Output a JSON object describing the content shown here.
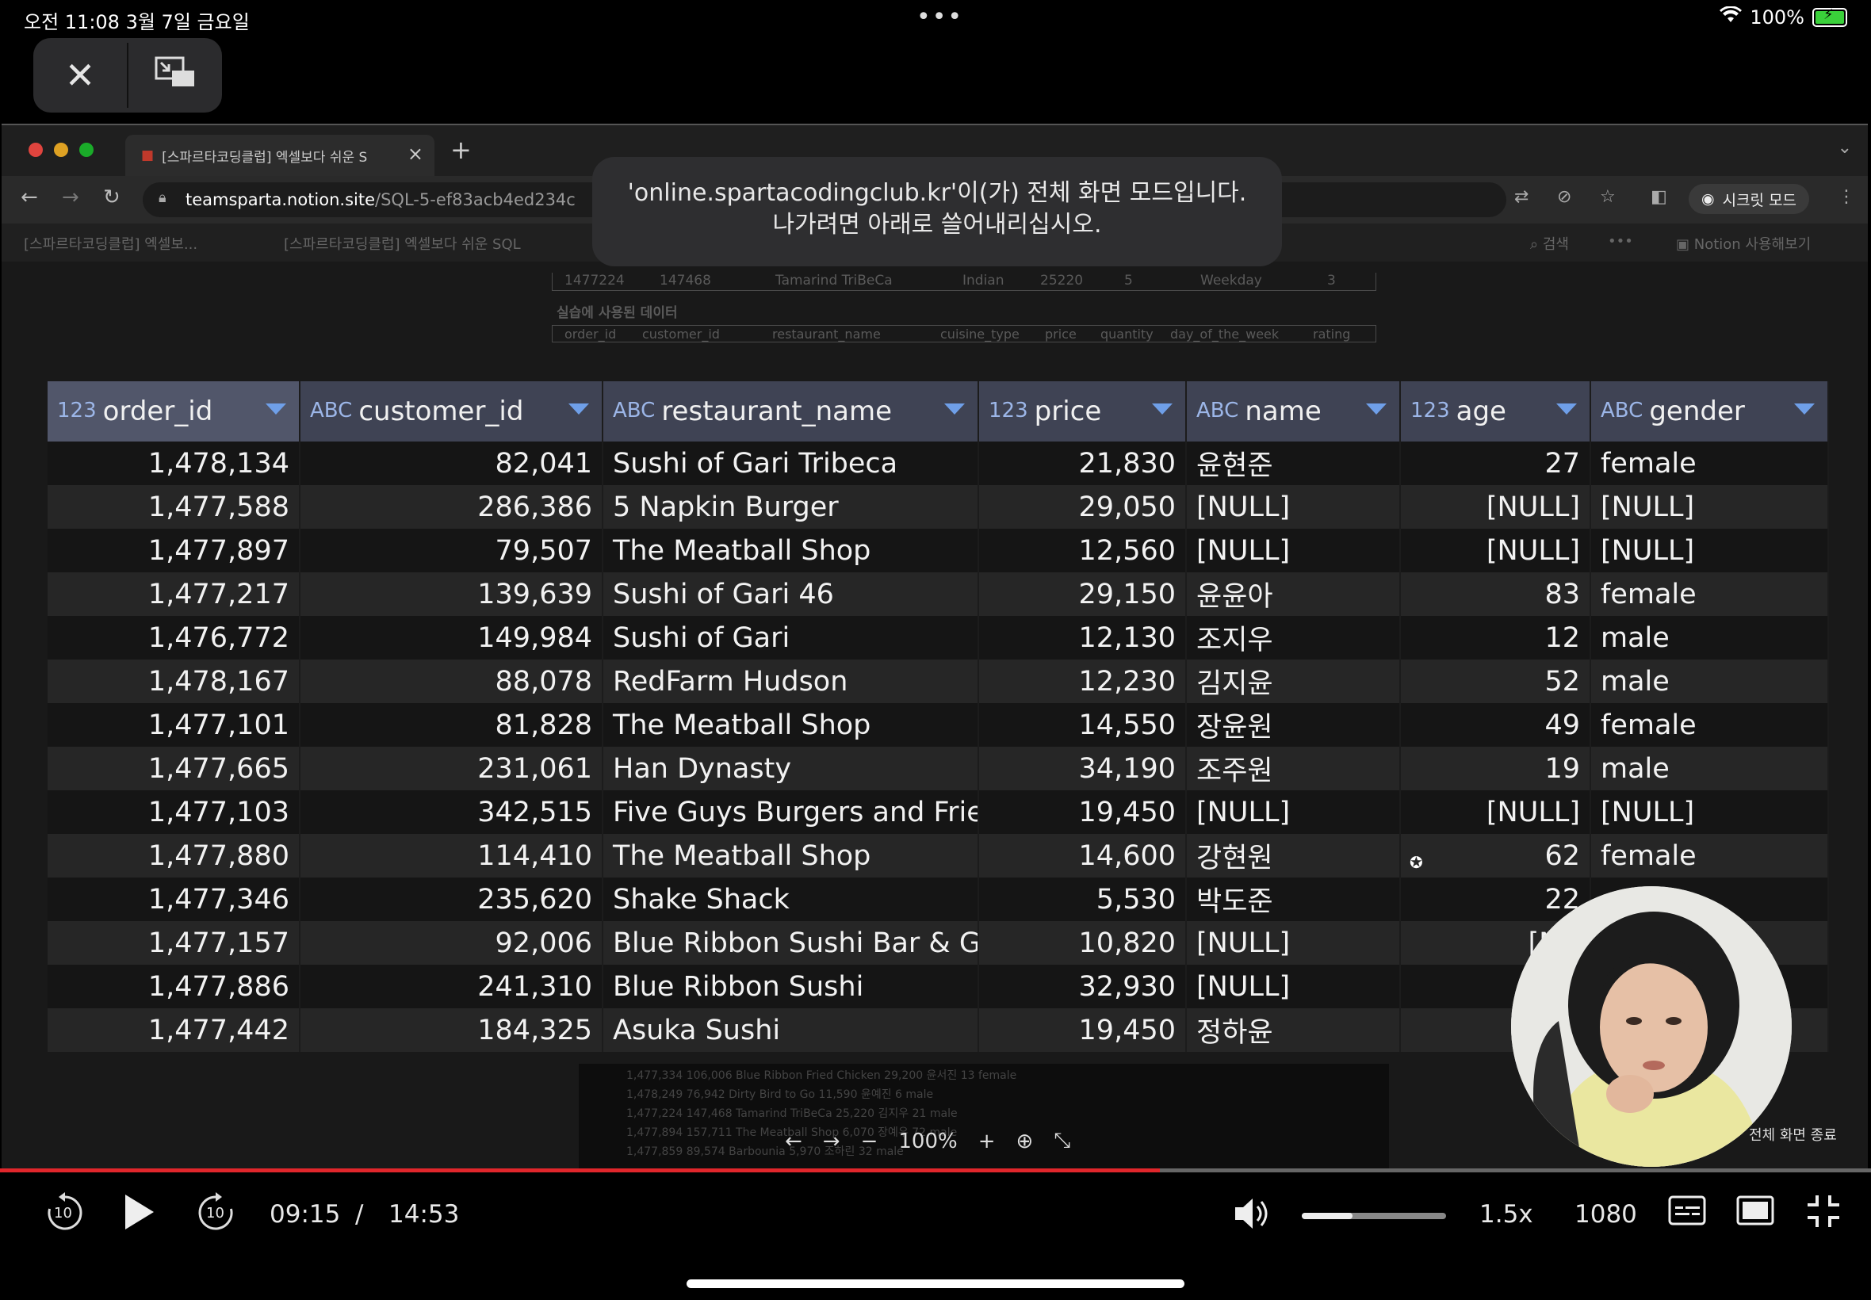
{
  "status_bar": {
    "time_date": "오전 11:08   3월 7일 금요일",
    "dots": "•••",
    "battery_text": "100%"
  },
  "pip": {
    "close_icon": "✕",
    "restore_icon": "⧉"
  },
  "browser": {
    "tab_title": "[스파르타코딩클럽] 엑셀보다 쉬운 S",
    "url_host": "teamsparta.notion.site",
    "url_path": "/SQL-5-ef83acb4ed234c",
    "incognito_label": "시크릿 모드",
    "bookmark_1": "[스파르타코딩클럽] 엑셀보...",
    "bookmark_2": "[스파르타코딩클럽] 엑셀보다 쉬운 SQL",
    "notion_search": "검색",
    "notion_try": "Notion 사용해보기",
    "faint_row": [
      "1477224",
      "147468",
      "Tamarind TriBeCa",
      "Indian",
      "25220",
      "5",
      "Weekday",
      "3"
    ],
    "faint_heading": "실습에 사용된 데이터",
    "faint_header": [
      "order_id",
      "customer_id",
      "restaurant_name",
      "cuisine_type",
      "price",
      "quantity",
      "day_of_the_week",
      "rating"
    ]
  },
  "fullscreen_notice": {
    "line1": "'online.spartacodingclub.kr'이(가) 전체 화면 모드입니다.",
    "line2": "나가려면 아래로 쓸어내리십시오."
  },
  "grid": {
    "columns": [
      {
        "type": "123",
        "name": "order_id"
      },
      {
        "type": "ABC",
        "name": "customer_id"
      },
      {
        "type": "ABC",
        "name": "restaurant_name"
      },
      {
        "type": "123",
        "name": "price"
      },
      {
        "type": "ABC",
        "name": "name"
      },
      {
        "type": "123",
        "name": "age"
      },
      {
        "type": "ABC",
        "name": "gender"
      }
    ],
    "rows": [
      [
        "1,478,134",
        "82,041",
        "Sushi of Gari Tribeca",
        "21,830",
        "윤현준",
        "27",
        "female"
      ],
      [
        "1,477,588",
        "286,386",
        "5 Napkin Burger",
        "29,050",
        "[NULL]",
        "[NULL]",
        "[NULL]"
      ],
      [
        "1,477,897",
        "79,507",
        "The Meatball Shop",
        "12,560",
        "[NULL]",
        "[NULL]",
        "[NULL]"
      ],
      [
        "1,477,217",
        "139,639",
        "Sushi of Gari 46",
        "29,150",
        "윤윤아",
        "83",
        "female"
      ],
      [
        "1,476,772",
        "149,984",
        "Sushi of Gari",
        "12,130",
        "조지우",
        "12",
        "male"
      ],
      [
        "1,478,167",
        "88,078",
        "RedFarm Hudson",
        "12,230",
        "김지윤",
        "52",
        "male"
      ],
      [
        "1,477,101",
        "81,828",
        "The Meatball Shop",
        "14,550",
        "장윤원",
        "49",
        "female"
      ],
      [
        "1,477,665",
        "231,061",
        "Han Dynasty",
        "34,190",
        "조주원",
        "19",
        "male"
      ],
      [
        "1,477,103",
        "342,515",
        "Five Guys Burgers and Fries",
        "19,450",
        "[NULL]",
        "[NULL]",
        "[NULL]"
      ],
      [
        "1,477,880",
        "114,410",
        "The Meatball Shop",
        "14,600",
        "강현원",
        "62",
        "female"
      ],
      [
        "1,477,346",
        "235,620",
        "Shake Shack",
        "5,530",
        "박도준",
        "22",
        ""
      ],
      [
        "1,477,157",
        "92,006",
        "Blue Ribbon Sushi Bar & Gri",
        "10,820",
        "[NULL]",
        "[NU",
        ""
      ],
      [
        "1,477,886",
        "241,310",
        "Blue Ribbon Sushi",
        "32,930",
        "[NULL]",
        "[N",
        ""
      ],
      [
        "1,477,442",
        "184,325",
        "Asuka Sushi",
        "19,450",
        "정하윤",
        "",
        ""
      ]
    ]
  },
  "viewer": {
    "zoom": "100%",
    "faint_rows": [
      "1,477,334     106,006     Blue Ribbon Fried Chicken     29,200   윤서진    13   female",
      "1,478,249      76,942     Dirty Bird to Go              11,590   윤예진     6   male",
      "1,477,224     147,468     Tamarind TriBeCa              25,220   김지우    21   male",
      "1,477,894     157,711     The Meatball Shop              6,070   장예우    72   male",
      "1,477,859      89,574     Barbounia                      5,970   조하린    32   male"
    ]
  },
  "webcam": {
    "exit_label": "전체 화면 종료"
  },
  "player": {
    "current_time": "09:15",
    "separator": "/",
    "duration": "14:53",
    "speed": "1.5x",
    "quality": "1080p",
    "progress": 0.62,
    "volume": 0.35,
    "skip_back_label": "10",
    "skip_forward_label": "10"
  }
}
